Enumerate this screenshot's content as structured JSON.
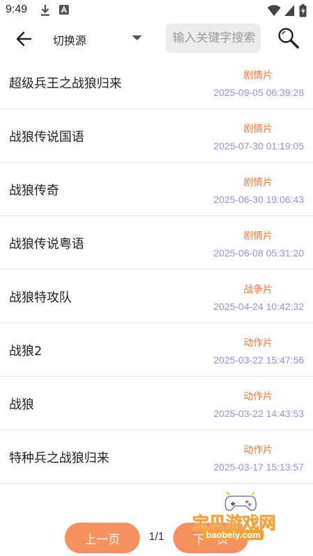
{
  "status_bar": {
    "time": "9:49",
    "icons": [
      "download-icon",
      "a-notification-icon",
      "wifi-icon",
      "signal-icon",
      "battery-icon"
    ]
  },
  "toolbar": {
    "back_icon": "arrow-left-icon",
    "source_label": "切换源",
    "search_placeholder": "输入关键字搜索",
    "search_icon": "search-icon"
  },
  "results": [
    {
      "title": "超级兵王之战狼归来",
      "genre": "剧情片",
      "date": "2025-09-05 06:39:28"
    },
    {
      "title": "战狼传说国语",
      "genre": "剧情片",
      "date": "2025-07-30 01:19:05"
    },
    {
      "title": "战狼传奇",
      "genre": "剧情片",
      "date": "2025-06-30 19:06:43"
    },
    {
      "title": "战狼传说粤语",
      "genre": "剧情片",
      "date": "2025-06-08 05:31:20"
    },
    {
      "title": "战狼特攻队",
      "genre": "战争片",
      "date": "2025-04-24 10:42:32"
    },
    {
      "title": "战狼2",
      "genre": "动作片",
      "date": "2025-03-22 15:47:56"
    },
    {
      "title": "战狼",
      "genre": "动作片",
      "date": "2025-03-22 14:43:53"
    },
    {
      "title": "特种兵之战狼归来",
      "genre": "动作片",
      "date": "2025-03-17 15:13:57"
    }
  ],
  "pager": {
    "prev_label": "上一页",
    "next_label": "下一页",
    "indicator": "1/1"
  },
  "watermark": {
    "text": "宝贝游戏网",
    "url": "baobeiy.com"
  },
  "colors": {
    "accent": "#f6915e",
    "genre": "#f07a3c",
    "date": "#9b8fd6"
  }
}
